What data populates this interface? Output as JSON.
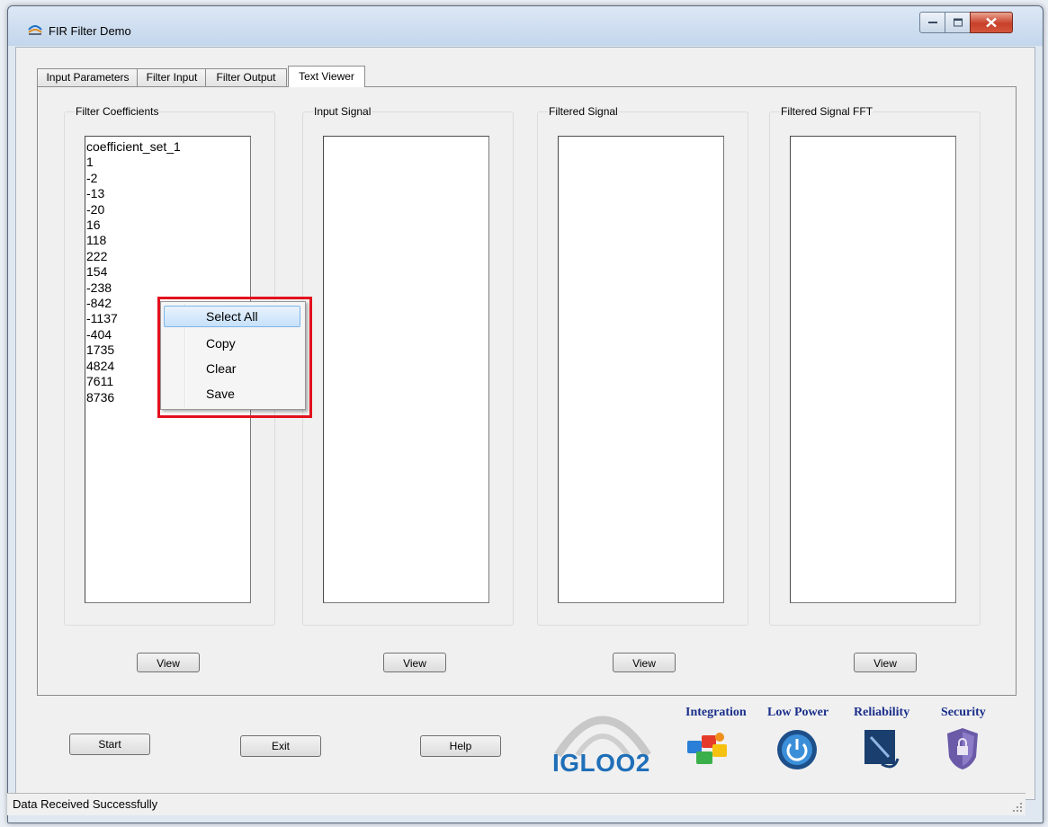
{
  "window": {
    "title": "FIR Filter Demo"
  },
  "tabs": [
    {
      "label": "Input Parameters",
      "active": false
    },
    {
      "label": "Filter Input",
      "active": false
    },
    {
      "label": "Filter Output",
      "active": false
    },
    {
      "label": "Text Viewer",
      "active": true
    }
  ],
  "panels": [
    {
      "label": "Filter Coefficients",
      "button": "View",
      "lines": [
        "coefficient_set_1",
        "1",
        "-2",
        "-13",
        "-20",
        "16",
        "118",
        "222",
        "154",
        "-238",
        "-842",
        "-1137",
        "-404",
        "1735",
        "4824",
        "7611",
        "8736"
      ]
    },
    {
      "label": "Input Signal",
      "button": "View",
      "lines": []
    },
    {
      "label": "Filtered Signal",
      "button": "View",
      "lines": []
    },
    {
      "label": "Filtered Signal FFT",
      "button": "View",
      "lines": []
    }
  ],
  "context_menu": {
    "items": [
      {
        "label": "Select All",
        "highlighted": true
      },
      {
        "label": "Copy",
        "highlighted": false
      },
      {
        "label": "Clear",
        "highlighted": false
      },
      {
        "label": "Save",
        "highlighted": false
      }
    ]
  },
  "bottom_buttons": {
    "start": "Start",
    "exit": "Exit",
    "help": "Help"
  },
  "branding": {
    "logo": "IGLOO2",
    "features": [
      "Integration",
      "Low Power",
      "Reliability",
      "Security"
    ]
  },
  "status": {
    "text": "Data Received Successfully"
  },
  "colors": {
    "highlight_box": "#e3101d",
    "brand_blue": "#1f6fb8",
    "feature_text": "#1a2f8a"
  }
}
